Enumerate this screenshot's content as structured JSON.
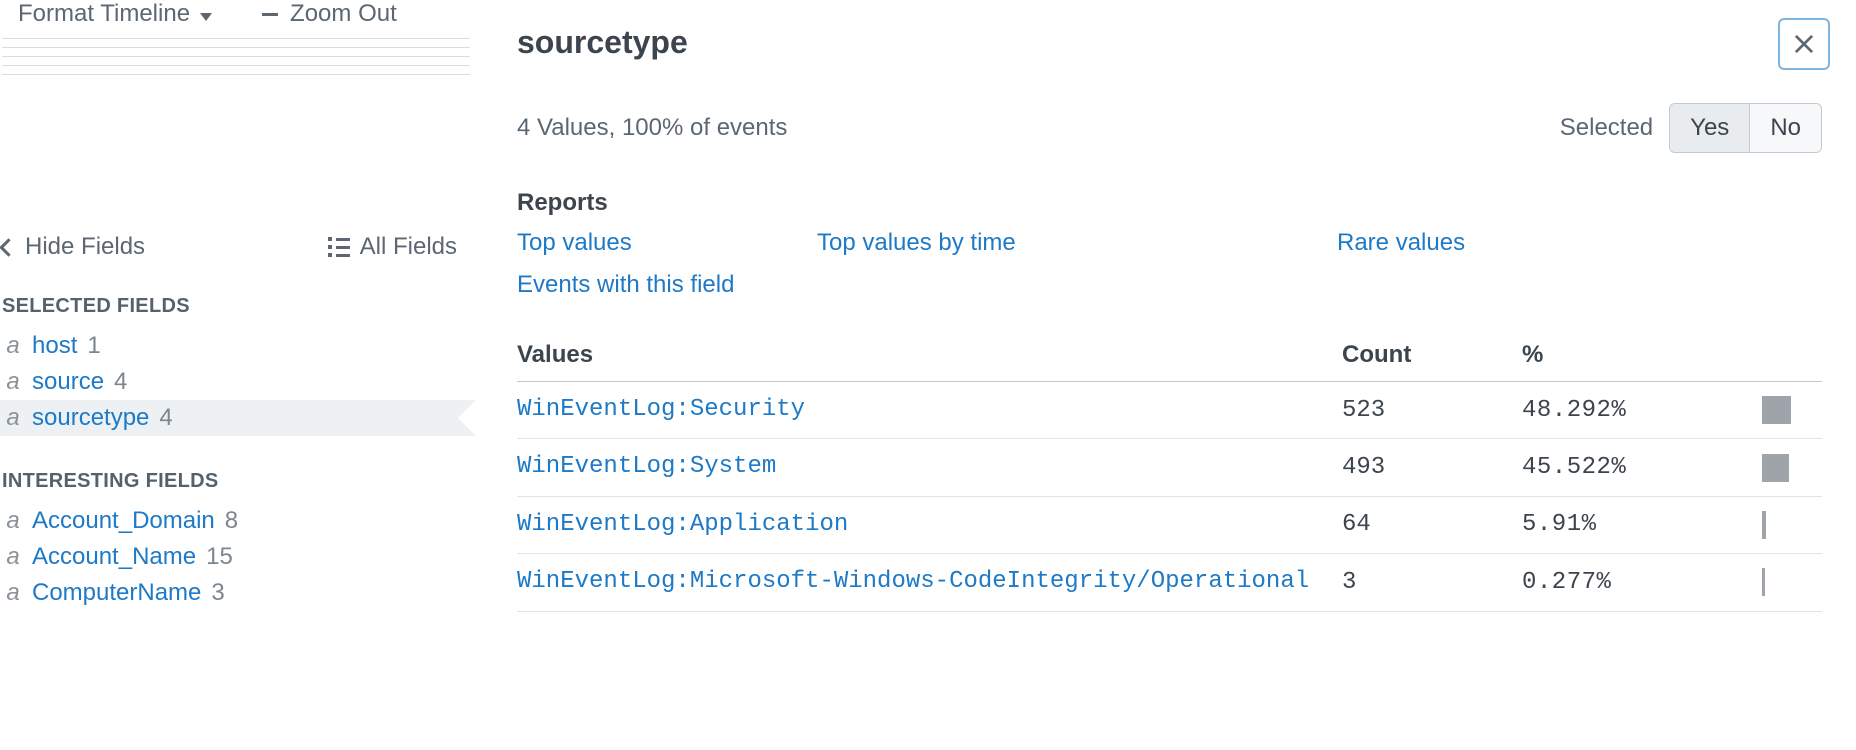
{
  "toolbar": {
    "format_timeline": "Format Timeline",
    "zoom_out": "Zoom Out"
  },
  "fieldsPanel": {
    "hide_fields": "Hide Fields",
    "all_fields": "All Fields",
    "selected_heading": "SELECTED FIELDS",
    "interesting_heading": "INTERESTING FIELDS",
    "selected": [
      {
        "type": "a",
        "name": "host",
        "count": "1"
      },
      {
        "type": "a",
        "name": "source",
        "count": "4"
      },
      {
        "type": "a",
        "name": "sourcetype",
        "count": "4"
      }
    ],
    "interesting": [
      {
        "type": "a",
        "name": "Account_Domain",
        "count": "8"
      },
      {
        "type": "a",
        "name": "Account_Name",
        "count": "15"
      },
      {
        "type": "a",
        "name": "ComputerName",
        "count": "3"
      }
    ]
  },
  "popover": {
    "title": "sourcetype",
    "summary": "4 Values, 100% of events",
    "selected_label": "Selected",
    "yes": "Yes",
    "no": "No",
    "reports_heading": "Reports",
    "reports": {
      "top_values": "Top values",
      "top_values_by_time": "Top values by time",
      "rare_values": "Rare values",
      "events_with_field": "Events with this field"
    },
    "columns": {
      "values": "Values",
      "count": "Count",
      "percent": "%"
    },
    "rows": [
      {
        "value": "WinEventLog:Security",
        "count": "523",
        "percent": "48.292%",
        "bar": 48.292
      },
      {
        "value": "WinEventLog:System",
        "count": "493",
        "percent": "45.522%",
        "bar": 45.522
      },
      {
        "value": "WinEventLog:Application",
        "count": "64",
        "percent": "5.91%",
        "bar": 5.91
      },
      {
        "value": "WinEventLog:Microsoft-Windows-CodeIntegrity/Operational",
        "count": "3",
        "percent": "0.277%",
        "bar": 0.277
      }
    ]
  }
}
